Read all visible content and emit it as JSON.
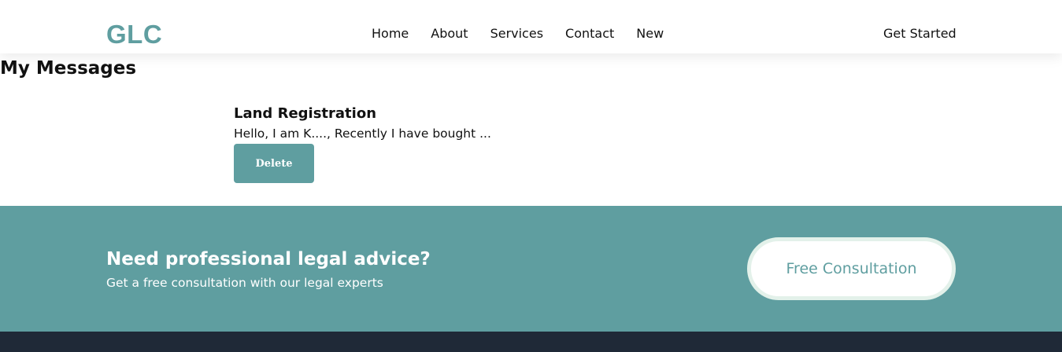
{
  "header": {
    "logo": "GLC",
    "nav": [
      {
        "label": "Home"
      },
      {
        "label": "About"
      },
      {
        "label": "Services"
      },
      {
        "label": "Contact"
      },
      {
        "label": "New"
      }
    ],
    "cta_label": "Get Started"
  },
  "main": {
    "title": "My Messages",
    "messages": [
      {
        "subject": "Land Registration",
        "preview": "Hello, I am K...., Recently I have bought ...",
        "delete_label": "Delete"
      }
    ]
  },
  "cta": {
    "heading": "Need professional legal advice?",
    "subtext": "Get a free consultation with our legal experts",
    "button_label": "Free Consultation"
  },
  "colors": {
    "accent": "#5f9ea0",
    "footer": "#1f2937",
    "button_ring": "#e3f1ea"
  }
}
